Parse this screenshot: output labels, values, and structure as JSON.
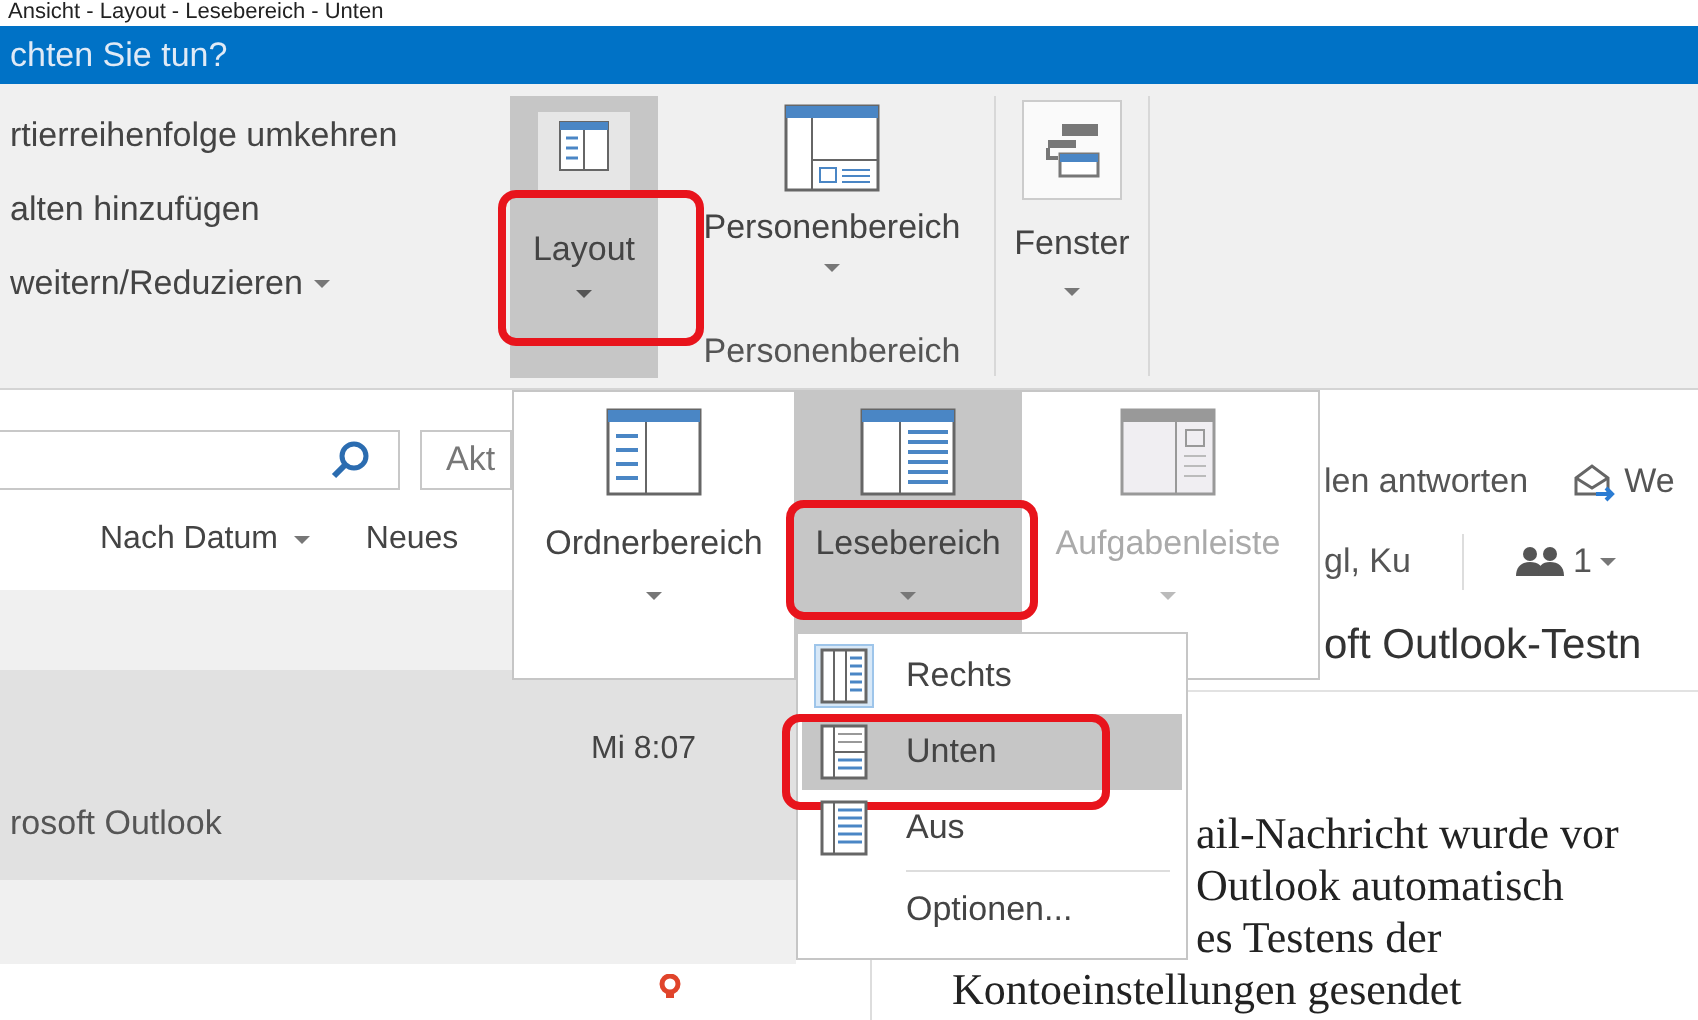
{
  "caption": "Ansicht - Layout - Lesebereich - Unten",
  "tell_me": {
    "text": "chten Sie tun?"
  },
  "ribbon": {
    "left_items": [
      {
        "label": "rtierreihenfolge umkehren",
        "dropdown": false
      },
      {
        "label": "alten hinzufügen",
        "dropdown": false
      },
      {
        "label": "weitern/Reduzieren",
        "dropdown": true
      }
    ],
    "layout_button": {
      "label": "Layout",
      "pressed": true,
      "marked": true
    },
    "people_group": {
      "button": "Personenbereich",
      "group_label": "Personenbereich"
    },
    "window_button": {
      "label": "Fenster"
    }
  },
  "mail_list": {
    "scope_field": "Akt",
    "sort": "Nach Datum",
    "order": "Neues",
    "items": [
      {
        "time": "Mi 8:07",
        "sender": "rosoft Outlook",
        "selected": true
      }
    ]
  },
  "reading_pane": {
    "actions": [
      {
        "kind": "text",
        "label": "len antworten"
      },
      {
        "kind": "forward",
        "label": "We"
      }
    ],
    "recipients": "gl, Ku",
    "people_count": "1",
    "subject": "oft Outlook-Testn",
    "body_lines": [
      {
        "kind": "beside-menu",
        "text": "ail-Nachricht wurde vor"
      },
      {
        "kind": "beside-menu",
        "text": "Outlook automatisch"
      },
      {
        "kind": "beside-menu",
        "text": "es Testens der"
      },
      {
        "kind": "full",
        "text": "Kontoeinstellungen gesendet"
      }
    ]
  },
  "layout_menu": {
    "buttons": [
      {
        "label": "Ordnerbereich",
        "kind": "folder",
        "pressed": false,
        "disabled": false,
        "marked": false
      },
      {
        "label": "Lesebereich",
        "kind": "reading",
        "pressed": true,
        "disabled": false,
        "marked": true
      },
      {
        "label": "Aufgabenleiste",
        "kind": "todo",
        "pressed": false,
        "disabled": true,
        "marked": false
      }
    ]
  },
  "reading_pane_menu": {
    "items": [
      {
        "kind": "right",
        "label": "Rechts",
        "checked": true,
        "highlighted": false,
        "marked": false
      },
      {
        "kind": "bottom",
        "label": "Unten",
        "checked": false,
        "highlighted": true,
        "marked": true
      },
      {
        "kind": "off",
        "label": "Aus",
        "checked": false,
        "highlighted": false,
        "marked": false
      },
      {
        "kind": "options",
        "label": "Optionen..."
      }
    ]
  }
}
